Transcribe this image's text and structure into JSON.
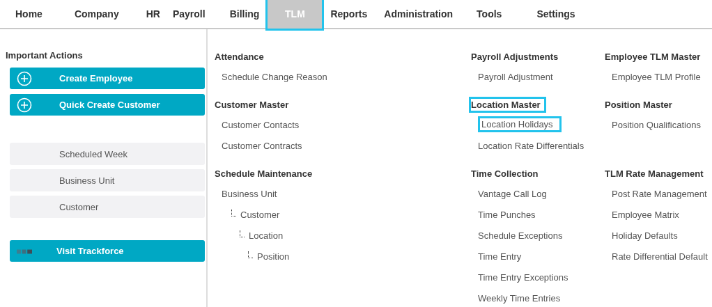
{
  "nav": {
    "tabs": [
      {
        "label": "Home",
        "selected": false,
        "highlighted": false
      },
      {
        "label": "Company",
        "selected": false,
        "highlighted": false
      },
      {
        "label": "HR",
        "selected": false,
        "highlighted": false
      },
      {
        "label": "Payroll",
        "selected": false,
        "highlighted": false
      },
      {
        "label": "Billing",
        "selected": false,
        "highlighted": false
      },
      {
        "label": "TLM",
        "selected": true,
        "highlighted": true
      },
      {
        "label": "Reports",
        "selected": false,
        "highlighted": false
      },
      {
        "label": "Administration",
        "selected": false,
        "highlighted": false
      },
      {
        "label": "Tools",
        "selected": false,
        "highlighted": false
      },
      {
        "label": "Settings",
        "selected": false,
        "highlighted": false
      }
    ]
  },
  "sidebar": {
    "title": "Important Actions",
    "actions": [
      {
        "label": "Create Employee",
        "kind": "add"
      },
      {
        "label": "Quick Create Customer",
        "kind": "add"
      }
    ],
    "shortcuts": [
      {
        "label": "Scheduled Week"
      },
      {
        "label": "Business Unit"
      },
      {
        "label": "Customer"
      }
    ],
    "links": [
      {
        "label": "Visit Trackforce",
        "kind": "external"
      }
    ]
  },
  "menu": {
    "columns": [
      {
        "sections": [
          {
            "title": "Attendance",
            "highlighted": false,
            "items": [
              {
                "label": "Schedule Change Reason",
                "highlighted": false
              }
            ]
          },
          {
            "title": "Customer Master",
            "highlighted": false,
            "items": [
              {
                "label": "Customer Contacts",
                "highlighted": false
              },
              {
                "label": "Customer Contracts",
                "highlighted": false
              }
            ]
          },
          {
            "title": "Schedule Maintenance",
            "highlighted": false,
            "items": [
              {
                "label": "Business Unit",
                "highlighted": false,
                "children": [
                  {
                    "label": "Customer",
                    "highlighted": false,
                    "children": [
                      {
                        "label": "Location",
                        "highlighted": false,
                        "children": [
                          {
                            "label": "Position",
                            "highlighted": false
                          }
                        ]
                      }
                    ]
                  }
                ]
              }
            ]
          }
        ]
      },
      {
        "sections": [
          {
            "title": "Payroll Adjustments",
            "highlighted": false,
            "items": [
              {
                "label": "Payroll Adjustment",
                "highlighted": false
              }
            ]
          },
          {
            "title": "Location Master",
            "highlighted": true,
            "items": [
              {
                "label": "Location Holidays",
                "highlighted": true
              },
              {
                "label": "Location Rate Differentials",
                "highlighted": false
              }
            ]
          },
          {
            "title": "Time Collection",
            "highlighted": false,
            "items": [
              {
                "label": "Vantage Call Log",
                "highlighted": false
              },
              {
                "label": "Time Punches",
                "highlighted": false
              },
              {
                "label": "Schedule Exceptions",
                "highlighted": false
              },
              {
                "label": "Time Entry",
                "highlighted": false
              },
              {
                "label": "Time Entry Exceptions",
                "highlighted": false
              },
              {
                "label": "Weekly Time Entries",
                "highlighted": false
              }
            ]
          }
        ]
      },
      {
        "sections": [
          {
            "title": "Employee TLM Master",
            "highlighted": false,
            "items": [
              {
                "label": "Employee TLM Profile",
                "highlighted": false
              }
            ]
          },
          {
            "title": "Position Master",
            "highlighted": false,
            "items": [
              {
                "label": "Position Qualifications",
                "highlighted": false
              }
            ]
          },
          {
            "title": "TLM Rate Management",
            "highlighted": false,
            "items": [
              {
                "label": "Post Rate Management",
                "highlighted": false
              },
              {
                "label": "Employee Matrix",
                "highlighted": false
              },
              {
                "label": "Holiday Defaults",
                "highlighted": false
              },
              {
                "label": "Rate Differential Default",
                "highlighted": false
              }
            ]
          }
        ]
      }
    ]
  }
}
